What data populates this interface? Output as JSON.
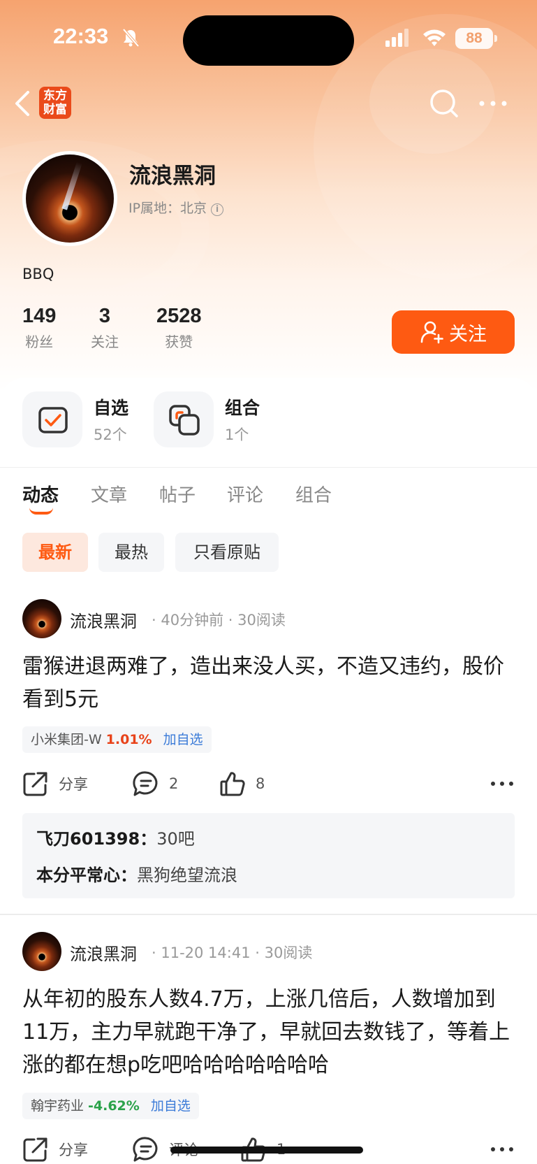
{
  "status_bar": {
    "time": "22:33",
    "battery": "88"
  },
  "nav": {
    "logo_line1": "东方",
    "logo_line2": "财富"
  },
  "profile": {
    "name": "流浪黑洞",
    "ip": "IP属地：北京",
    "bio": "BBQ",
    "stats": [
      {
        "num": "149",
        "label": "粉丝"
      },
      {
        "num": "3",
        "label": "关注"
      },
      {
        "num": "2528",
        "label": "获赞"
      }
    ],
    "follow_label": "关注"
  },
  "quick": [
    {
      "title": "自选",
      "sub": "52个"
    },
    {
      "title": "组合",
      "sub": "1个"
    }
  ],
  "tabs": [
    "动态",
    "文章",
    "帖子",
    "评论",
    "组合"
  ],
  "filters": [
    "最新",
    "最热",
    "只看原贴"
  ],
  "posts": [
    {
      "author": "流浪黑洞",
      "meta": "· 40分钟前 · 30阅读",
      "text": "雷猴进退两难了，造出来没人买，不造又违约，股价看到5元",
      "stock": {
        "name": "小米集团-W",
        "change": "1.01%",
        "add": "加自选",
        "direction": "up"
      },
      "share": "分享",
      "comments": "2",
      "likes": "8",
      "comment_preview": [
        {
          "user": "飞刀601398：",
          "text": "30吧"
        },
        {
          "user": "本分平常心：",
          "text": "黑狗绝望流浪"
        }
      ]
    },
    {
      "author": "流浪黑洞",
      "meta": "· 11-20 14:41 · 30阅读",
      "text": "从年初的股东人数4.7万，上涨几倍后，人数增加到11万，主力早就跑干净了，早就回去数钱了，等着上涨的都在想p吃吧哈哈哈哈哈哈哈",
      "stock": {
        "name": "翰宇药业",
        "change": "-4.62%",
        "add": "加自选",
        "direction": "down"
      },
      "share": "分享",
      "comments": "评论",
      "likes": "1"
    }
  ],
  "colors": {
    "accent": "#fe5a12",
    "up": "#e8431a",
    "down": "#2ba24a",
    "link": "#3b7bd8"
  }
}
